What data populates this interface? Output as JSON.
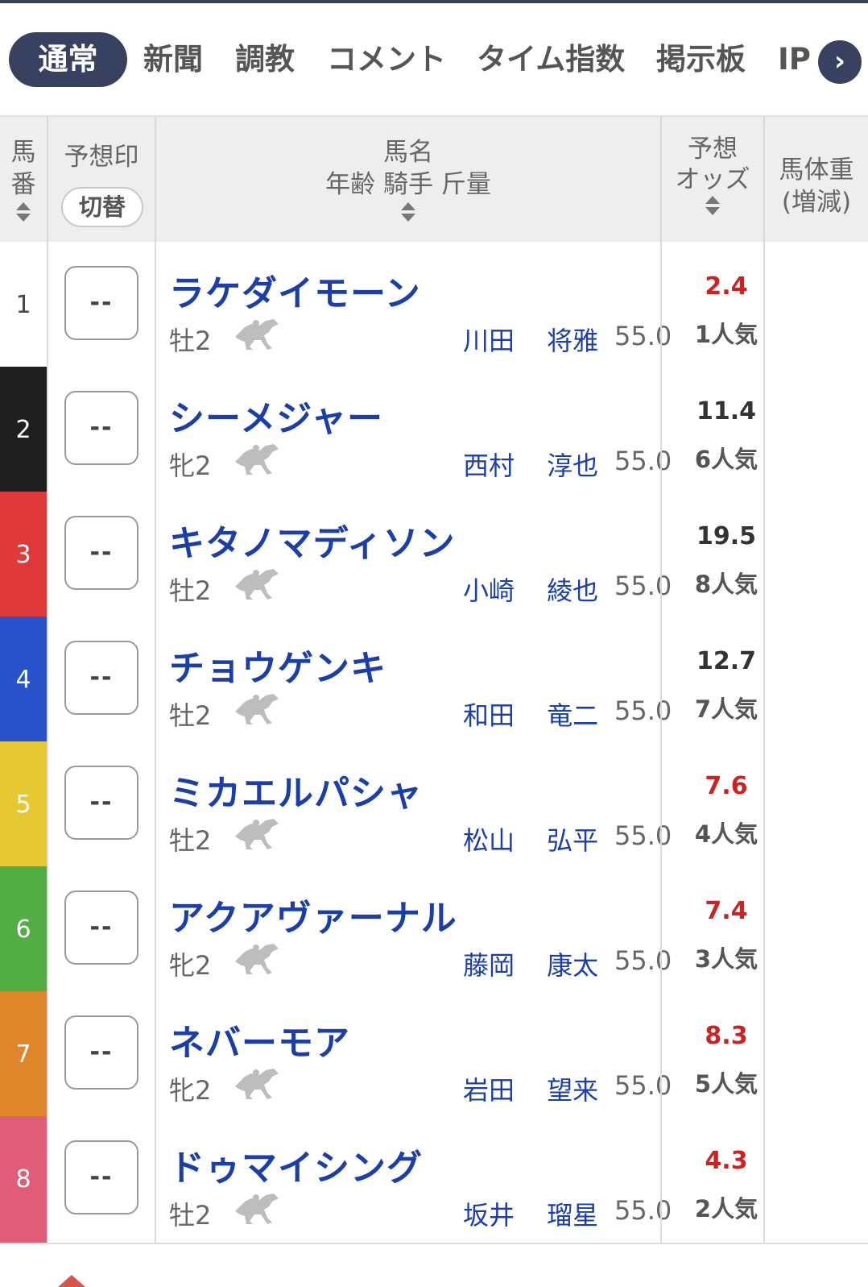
{
  "tabs": [
    {
      "label": "通常",
      "active": true
    },
    {
      "label": "新聞"
    },
    {
      "label": "調教"
    },
    {
      "label": "コメント"
    },
    {
      "label": "タイム指数"
    },
    {
      "label": "掲示板"
    },
    {
      "label": "IP"
    }
  ],
  "header": {
    "umaban_line1": "馬",
    "umaban_line2": "番",
    "mark_title": "予想印",
    "mark_switch": "切替",
    "name_line1": "馬名",
    "name_line2": "年齢 騎手 斤量",
    "odds_line1": "予想",
    "odds_line2": "オッズ",
    "weight_line1": "馬体重",
    "weight_line2": "(増減)"
  },
  "horses": [
    {
      "num": "1",
      "mark": "--",
      "name": "ラケダイモーン",
      "sex_age": "牡2",
      "jockey": "川田 将雅",
      "weight": "55.0",
      "odds": "2.4",
      "popularity": "1人気",
      "odds_hot": true,
      "frame_color": "#ffffff",
      "num_color": "#444444"
    },
    {
      "num": "2",
      "mark": "--",
      "name": "シーメジャー",
      "sex_age": "牝2",
      "jockey": "西村 淳也",
      "weight": "55.0",
      "odds": "11.4",
      "popularity": "6人気",
      "odds_hot": false,
      "frame_color": "#1e1e1e",
      "num_color": "#ffffff"
    },
    {
      "num": "3",
      "mark": "--",
      "name": "キタノマディソン",
      "sex_age": "牡2",
      "jockey": "小崎 綾也",
      "weight": "55.0",
      "odds": "19.5",
      "popularity": "8人気",
      "odds_hot": false,
      "frame_color": "#e0393a",
      "num_color": "#ffffff"
    },
    {
      "num": "4",
      "mark": "--",
      "name": "チョウゲンキ",
      "sex_age": "牡2",
      "jockey": "和田 竜二",
      "weight": "55.0",
      "odds": "12.7",
      "popularity": "7人気",
      "odds_hot": false,
      "frame_color": "#2752c9",
      "num_color": "#ffffff"
    },
    {
      "num": "5",
      "mark": "--",
      "name": "ミカエルパシャ",
      "sex_age": "牡2",
      "jockey": "松山 弘平",
      "weight": "55.0",
      "odds": "7.6",
      "popularity": "4人気",
      "odds_hot": true,
      "frame_color": "#e5c832",
      "num_color": "#ffffff"
    },
    {
      "num": "6",
      "mark": "--",
      "name": "アクアヴァーナル",
      "sex_age": "牝2",
      "jockey": "藤岡 康太",
      "weight": "55.0",
      "odds": "7.4",
      "popularity": "3人気",
      "odds_hot": true,
      "frame_color": "#52ad45",
      "num_color": "#ffffff"
    },
    {
      "num": "7",
      "mark": "--",
      "name": "ネバーモア",
      "sex_age": "牝2",
      "jockey": "岩田 望来",
      "weight": "55.0",
      "odds": "8.3",
      "popularity": "5人気",
      "odds_hot": true,
      "frame_color": "#e0862a",
      "num_color": "#ffffff"
    },
    {
      "num": "8",
      "mark": "--",
      "name": "ドゥマイシング",
      "sex_age": "牡2",
      "jockey": "坂井 瑠星",
      "weight": "55.0",
      "odds": "4.3",
      "popularity": "2人気",
      "odds_hot": true,
      "frame_color": "#e15c79",
      "num_color": "#ffffff"
    }
  ],
  "icons": {
    "next": "chevron-right-icon",
    "horse": "horse-icon",
    "sort": "sort-icon"
  }
}
